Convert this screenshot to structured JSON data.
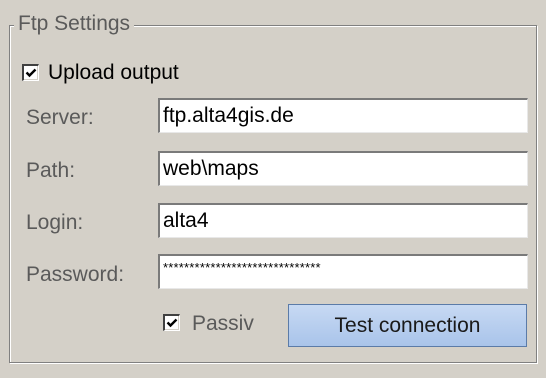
{
  "group": {
    "title": "Ftp Settings"
  },
  "upload": {
    "label": "Upload output",
    "checked": true
  },
  "server": {
    "label": "Server:",
    "value": "ftp.alta4gis.de"
  },
  "path": {
    "label": "Path:",
    "value": "web\\maps"
  },
  "login": {
    "label": "Login:",
    "value": "alta4"
  },
  "password": {
    "label": "Password:",
    "value": "******************************"
  },
  "passiv": {
    "label": "Passiv",
    "checked": true
  },
  "test_button": {
    "label": "Test connection"
  },
  "icons": {
    "upload_check": "checkmark-icon",
    "passiv_check": "checkmark-icon"
  }
}
